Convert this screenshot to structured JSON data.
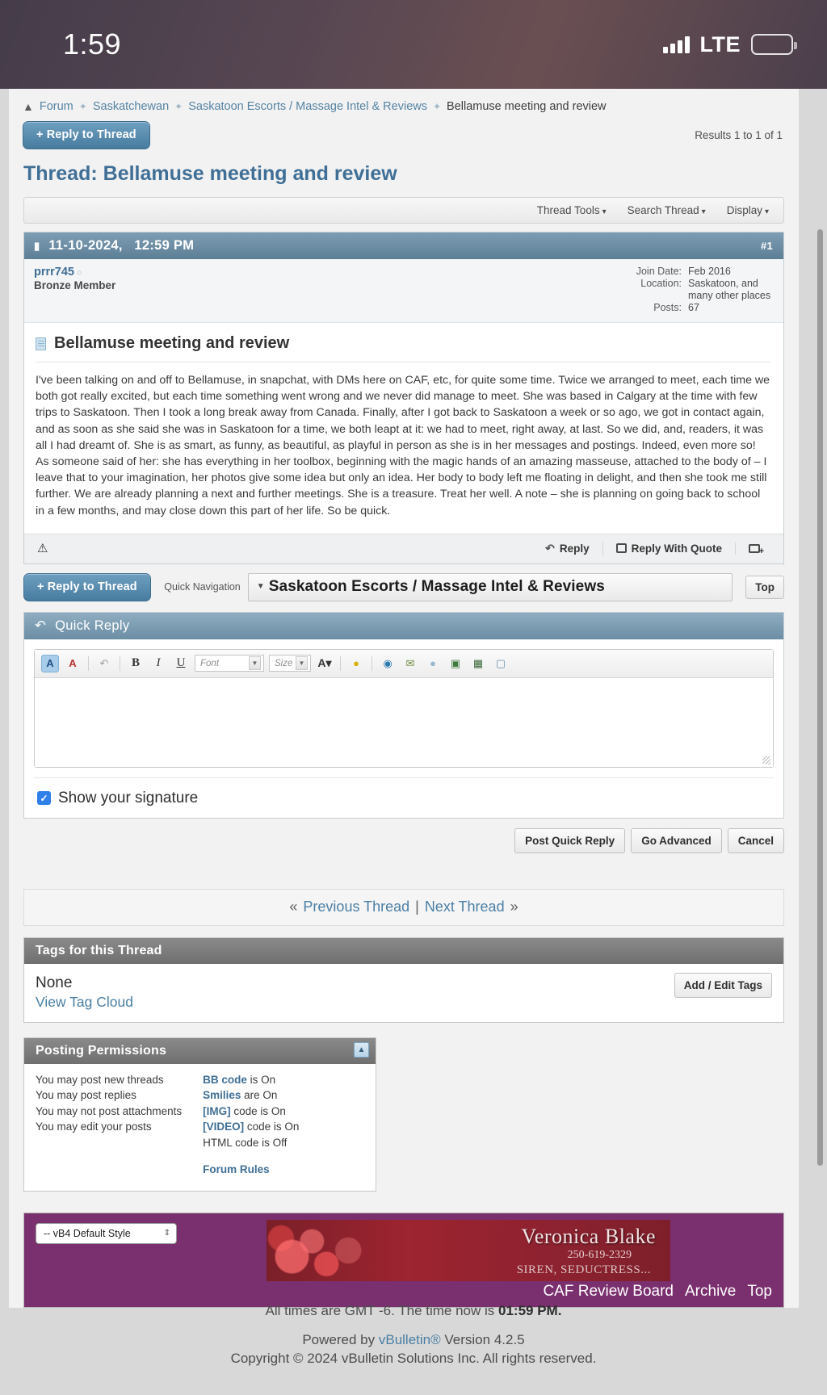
{
  "status_bar": {
    "time": "1:59",
    "network": "LTE",
    "signal_icon": "signal-bars-icon",
    "battery_icon": "battery-icon"
  },
  "breadcrumb": {
    "home_icon": "home-icon",
    "items": [
      "Forum",
      "Saskatchewan",
      "Saskatoon Escorts / Massage Intel & Reviews"
    ],
    "current": "Bellamuse meeting and review"
  },
  "toolbar_top": {
    "reply_button": "+ Reply to Thread",
    "results": "Results 1 to 1 of 1"
  },
  "thread": {
    "prefix": "Thread:",
    "title": "Bellamuse meeting and review"
  },
  "thread_tools": {
    "thread_tools": "Thread Tools",
    "search_thread": "Search Thread",
    "display": "Display"
  },
  "post": {
    "date": "11-10-2024,",
    "time": "12:59 PM",
    "number": "#1",
    "author": "prrr745",
    "rank": "Bronze Member",
    "stats": [
      {
        "label": "Join Date:",
        "value": "Feb 2016"
      },
      {
        "label": "Location:",
        "value": "Saskatoon, and"
      },
      {
        "label": "",
        "value": "many other places"
      },
      {
        "label": "Posts:",
        "value": "67"
      }
    ],
    "subject": "Bellamuse meeting and review",
    "body": "I've been talking on and off to Bellamuse, in snapchat, with DMs here on CAF, etc, for quite some time. Twice we arranged to meet, each time we both got really excited, but each time something went wrong and we never did manage to meet. She was based in Calgary at the time with few trips to Saskatoon. Then I took a long break away from Canada. Finally, after I got back to Saskatoon a week or so ago, we got in contact again, and as soon as she said she was in Saskatoon for a time, we both leapt at it: we had to meet, right away, at last. So we did, and, readers, it was all I had dreamt of. She is as smart, as funny, as beautiful, as playful in person as she is in her messages and postings. Indeed, even more so! As someone said of her: she has everything in her toolbox, beginning with the magic hands of an amazing masseuse, attached to the body of – I leave that to your imagination, her photos give some idea but only an idea. Her body to body left me floating in delight, and then she took me still further. We are already planning a next and further meetings. She is a treasure. Treat her well. A note – she is planning on going back to school in a few months, and may close down this part of her life. So be quick.",
    "actions": {
      "report_icon": "warning-triangle-icon",
      "reply": "Reply",
      "reply_with_quote": "Reply With Quote",
      "multi_quote": "multi-quote-icon"
    }
  },
  "quick_nav": {
    "reply_button": "+ Reply to Thread",
    "label": "Quick Navigation",
    "selected": "Saskatoon Escorts / Massage Intel & Reviews",
    "top_button": "Top"
  },
  "quick_reply": {
    "header": "Quick Reply",
    "header_icon": "reply-arrow-icon",
    "toolbar": [
      {
        "name": "remove-text-formatting-icon",
        "glyph": "A"
      },
      {
        "name": "text-color-icon",
        "glyph": "A"
      },
      {
        "name": "undo-icon",
        "glyph": "↺"
      },
      {
        "name": "bold-icon",
        "glyph": "B"
      },
      {
        "name": "italic-icon",
        "glyph": "I"
      },
      {
        "name": "underline-icon",
        "glyph": "U"
      },
      {
        "name": "font-family-select",
        "glyph": "Font"
      },
      {
        "name": "font-size-select",
        "glyph": "Size"
      },
      {
        "name": "font-color-icon",
        "glyph": "A"
      },
      {
        "name": "smilie-icon",
        "glyph": "☺"
      },
      {
        "name": "insert-link-icon",
        "glyph": "🌐"
      },
      {
        "name": "email-link-icon",
        "glyph": "✉"
      },
      {
        "name": "unlink-icon",
        "glyph": "○"
      },
      {
        "name": "insert-image-icon",
        "glyph": "▣"
      },
      {
        "name": "insert-video-icon",
        "glyph": "▤"
      },
      {
        "name": "wrap-quotes-icon",
        "glyph": "❝"
      }
    ],
    "textarea_value": "",
    "signature_label": "Show your signature",
    "signature_checked": true,
    "buttons": [
      "Post Quick Reply",
      "Go Advanced",
      "Cancel"
    ]
  },
  "thread_nav": {
    "prev_symbol": "«",
    "prev": "Previous Thread",
    "divider": "|",
    "next": "Next Thread",
    "next_symbol": "»"
  },
  "tags": {
    "header": "Tags for this Thread",
    "none": "None",
    "view_cloud": "View Tag Cloud",
    "add_edit": "Add / Edit Tags"
  },
  "permissions": {
    "header": "Posting Permissions",
    "collapse_icon": "collapse-icon",
    "left": [
      "You may post new threads",
      "You may post replies",
      "You may not post attachments",
      "You may edit your posts"
    ],
    "right": [
      {
        "code": "BB code",
        "rest": " is On"
      },
      {
        "code": "Smilies",
        "rest": " are On"
      },
      {
        "code": "[IMG]",
        "rest": " code is On"
      },
      {
        "code": "[VIDEO]",
        "rest": " code is On"
      },
      {
        "code": "",
        "rest": "HTML code is Off"
      }
    ],
    "forum_rules": "Forum Rules"
  },
  "footer_band": {
    "style_selector": "-- vB4 Default Style",
    "banner": {
      "name": "Veronica Blake",
      "phone": "250-619-2329",
      "tagline": "SIREN, SEDUCTRESS..."
    },
    "links": [
      "CAF Review Board",
      "Archive",
      "Top"
    ]
  },
  "footer": {
    "timezone": "All times are GMT -6. The time now is",
    "time_now": "01:59 PM.",
    "powered_prefix": "Powered by",
    "vbulletin": "vBulletin®",
    "version": "Version 4.2.5",
    "copyright": "Copyright © 2024 vBulletin Solutions Inc. All rights reserved."
  },
  "colors": {
    "accent": "#4a7fa5",
    "post_header": "#6d8fa6",
    "band": "#7a2f6e"
  }
}
